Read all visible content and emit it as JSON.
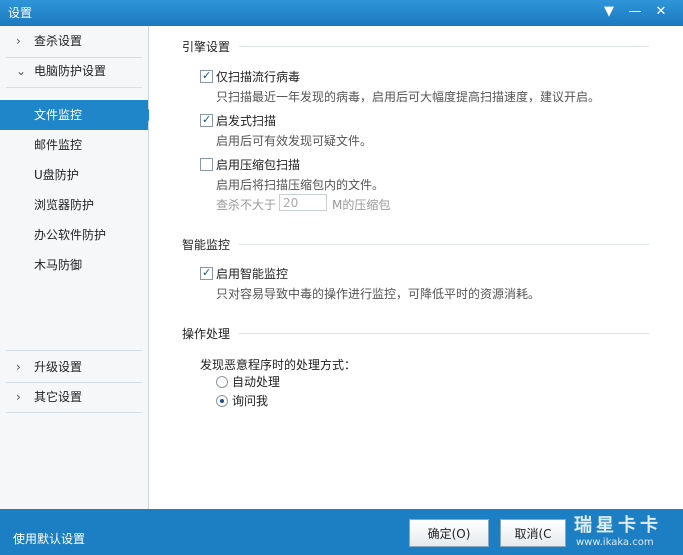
{
  "window": {
    "title": "设置",
    "skin_icon": "shirt-icon",
    "min_icon": "minimize-icon",
    "close_icon": "close-icon"
  },
  "sidebar": {
    "top_items": [
      {
        "label": "查杀设置",
        "icon": "chevron-right-icon"
      },
      {
        "label": "电脑防护设置",
        "icon": "chevron-down-icon"
      }
    ],
    "sub_items": [
      {
        "label": "文件监控",
        "active": true
      },
      {
        "label": "邮件监控"
      },
      {
        "label": "U盘防护"
      },
      {
        "label": "浏览器防护"
      },
      {
        "label": "办公软件防护"
      },
      {
        "label": "木马防御"
      }
    ],
    "bottom_items": [
      {
        "label": "升级设置",
        "icon": "chevron-right-icon"
      },
      {
        "label": "其它设置",
        "icon": "chevron-right-icon"
      }
    ]
  },
  "engine": {
    "header": "引擎设置",
    "options": [
      {
        "label": "仅扫描流行病毒",
        "checked": true,
        "desc": "只扫描最近一年发现的病毒，启用后可大幅度提高扫描速度，建议开启。"
      },
      {
        "label": "启发式扫描",
        "checked": true,
        "desc": "启用后可有效发现可疑文件。"
      },
      {
        "label": "启用压缩包扫描",
        "checked": false,
        "desc": "启用后将扫描压缩包内的文件。"
      }
    ],
    "size_limit": {
      "prefix": "查杀不大于",
      "value": "20",
      "suffix": "M的压缩包"
    }
  },
  "smart": {
    "header": "智能监控",
    "option": {
      "label": "启用智能监控",
      "checked": true,
      "desc": "只对容易导致中毒的操作进行监控，可降低平时的资源消耗。"
    }
  },
  "action": {
    "header": "操作处理",
    "prompt": "发现恶意程序时的处理方式：",
    "radios": [
      {
        "label": "自动处理",
        "selected": false
      },
      {
        "label": "询问我",
        "selected": true
      }
    ]
  },
  "footer": {
    "default_link": "使用默认设置",
    "ok_label": "确定(O)",
    "cancel_label": "取消(C"
  },
  "watermark": {
    "line1": "瑞星卡卡",
    "line2": "www.ikaka.com"
  }
}
